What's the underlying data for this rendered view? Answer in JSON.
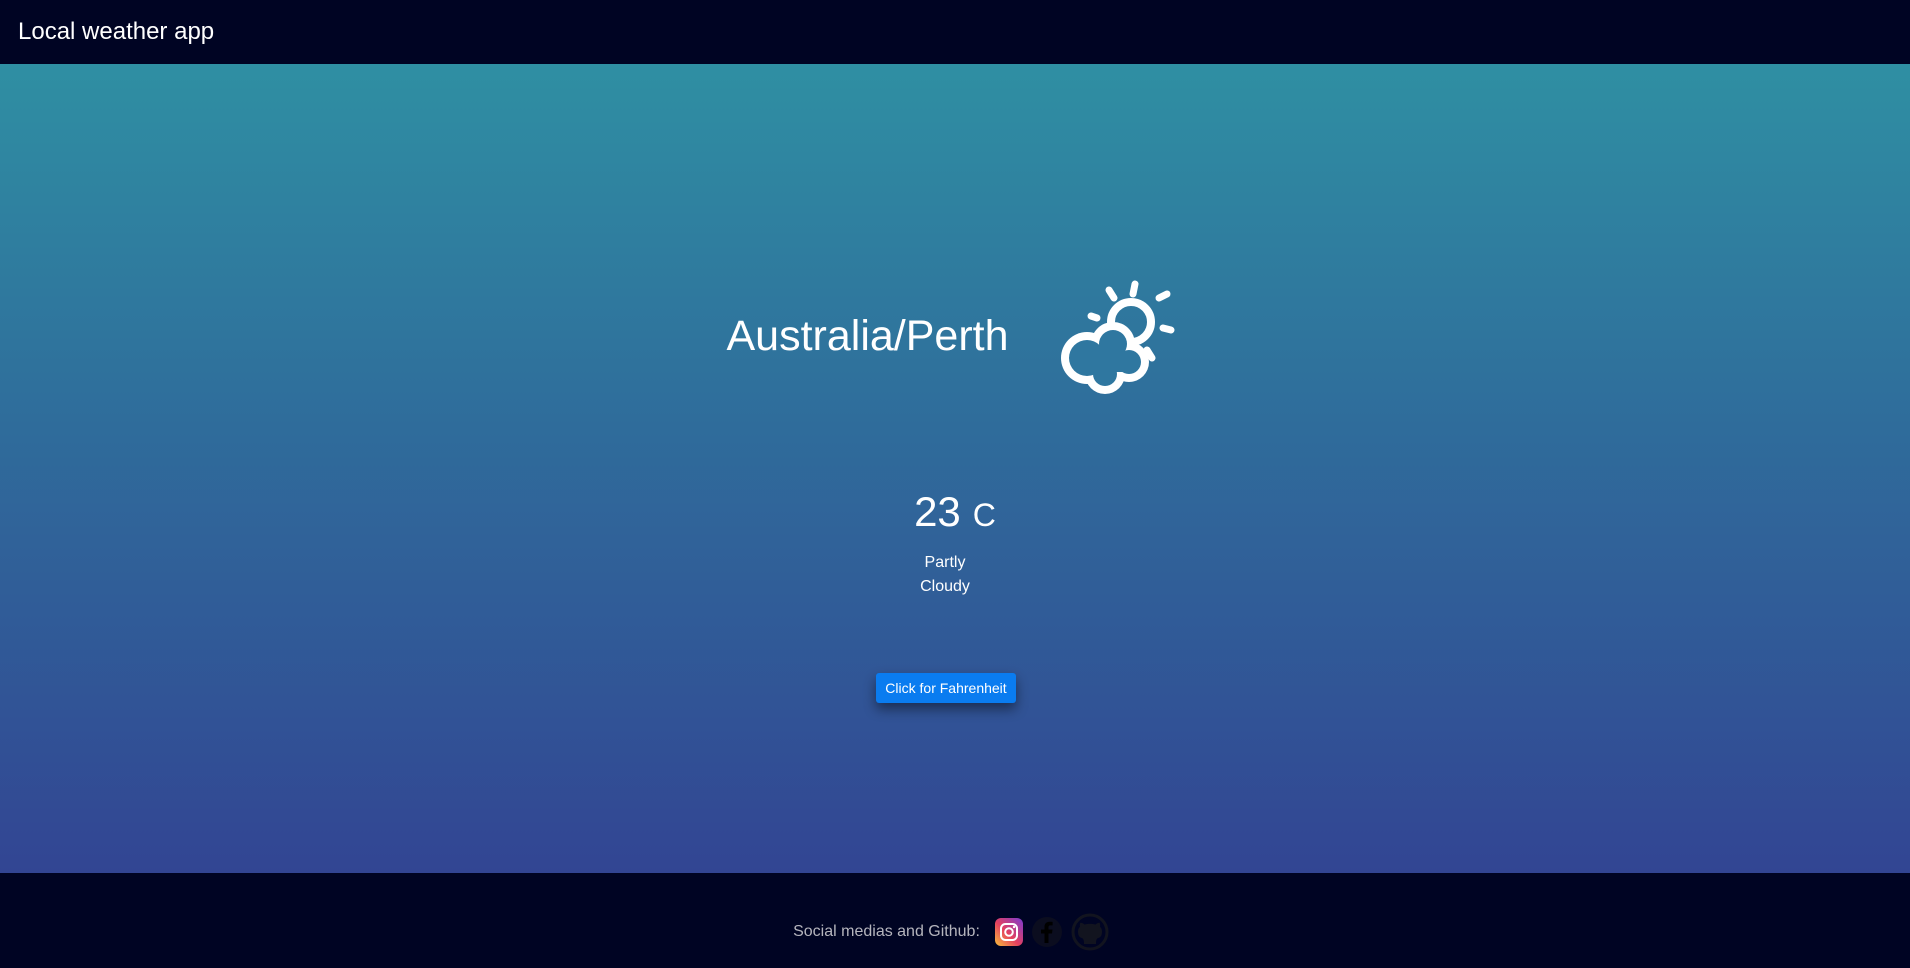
{
  "header": {
    "title": "Local weather app"
  },
  "weather": {
    "location": "Australia/Perth",
    "icon": "partly-cloudy-icon",
    "temperature": "23",
    "unit": "C",
    "condition": "Partly Cloudy",
    "toggle_label": "Click for Fahrenheit"
  },
  "footer": {
    "label": "Social medias and Github:",
    "links": [
      "instagram-icon",
      "facebook-icon",
      "github-icon"
    ]
  },
  "colors": {
    "navbar": "#000423",
    "gradient_top": "#2f8fa3",
    "gradient_bottom": "#324593",
    "button": "#0a7cf0"
  }
}
